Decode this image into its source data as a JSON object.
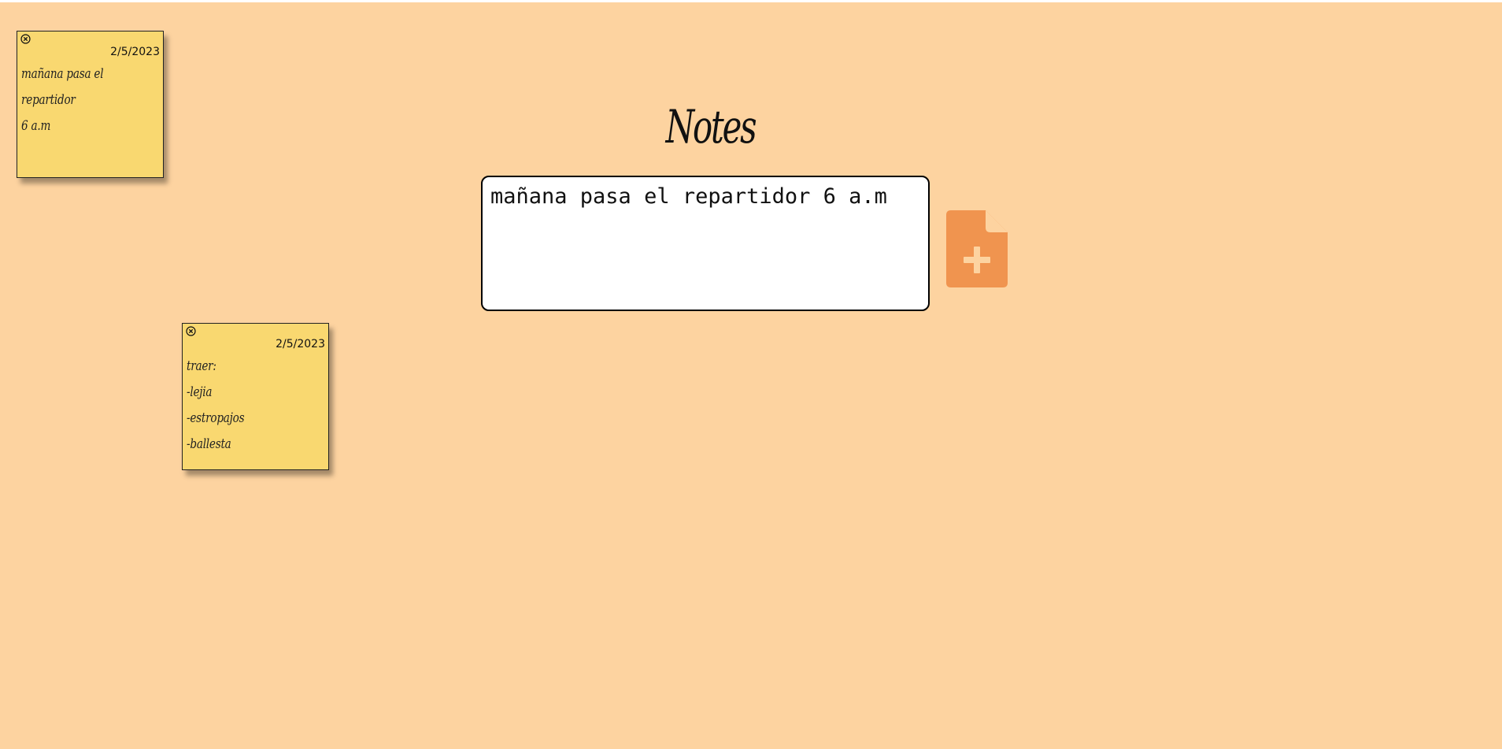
{
  "header": {
    "title": "Notes"
  },
  "composer": {
    "value": "mañana pasa el repartidor 6 a.m",
    "add_button_icon": "file-add-icon"
  },
  "notes": [
    {
      "date": "2/5/2023",
      "text": "mañana pasa el repartidor\n6 a.m",
      "close_icon": "close-circle-icon"
    },
    {
      "date": "2/5/2023",
      "text": "traer:\n-lejia\n-estropajos\n-ballesta",
      "close_icon": "close-circle-icon"
    }
  ],
  "colors": {
    "background": "#fdd3a0",
    "note": "#f9d870",
    "accent": "#f0944f",
    "accent_light": "#fdd3a0"
  }
}
